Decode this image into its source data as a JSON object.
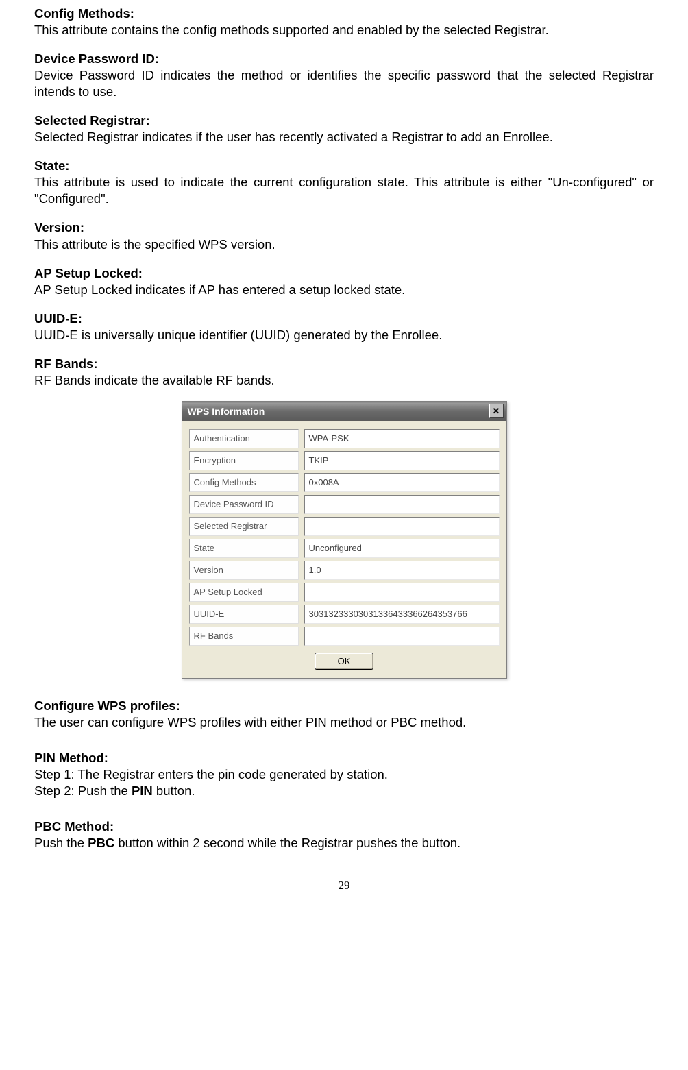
{
  "sections": {
    "configMethods": {
      "heading": "Config Methods:",
      "body": "This attribute contains the config methods supported and enabled by the selected Registrar."
    },
    "devicePasswordId": {
      "heading": "Device Password ID:",
      "body": "Device Password ID indicates the method or identifies the specific password that the selected Registrar intends to use."
    },
    "selectedRegistrar": {
      "heading": "Selected Registrar:",
      "body": "Selected Registrar indicates if the user has recently activated a Registrar to add an Enrollee."
    },
    "state": {
      "heading": "State:",
      "body": "This attribute is used to indicate the current configuration state. This attribute is either \"Un-configured\" or \"Configured\"."
    },
    "version": {
      "heading": "Version:",
      "body": "This attribute is the specified WPS version."
    },
    "apSetupLocked": {
      "heading": "AP Setup Locked:",
      "body": "AP Setup Locked indicates if AP has entered a setup locked state."
    },
    "uuidE": {
      "heading": "UUID-E:",
      "body": "UUID-E is universally unique identifier (UUID) generated by the Enrollee."
    },
    "rfBands": {
      "heading": "RF Bands:",
      "body": "RF Bands indicate the available RF bands."
    },
    "configureWps": {
      "heading": "Configure WPS profiles:",
      "body": "The user can configure WPS profiles with either PIN method or PBC method."
    },
    "pinMethod": {
      "heading": "PIN Method:",
      "step1": "Step 1: The Registrar enters the pin code generated by station.",
      "step2a": "Step 2: Push the ",
      "step2b": "PIN",
      "step2c": " button."
    },
    "pbcMethod": {
      "heading": "PBC Method:",
      "body1": "Push the ",
      "body2": "PBC",
      "body3": " button within 2 second while the Registrar pushes the button."
    }
  },
  "dialog": {
    "title": "WPS Information",
    "closeGlyph": "✕",
    "fields": [
      {
        "label": "Authentication",
        "value": "WPA-PSK"
      },
      {
        "label": "Encryption",
        "value": "TKIP"
      },
      {
        "label": "Config Methods",
        "value": "0x008A"
      },
      {
        "label": "Device Password ID",
        "value": ""
      },
      {
        "label": "Selected Registrar",
        "value": ""
      },
      {
        "label": "State",
        "value": "Unconfigured"
      },
      {
        "label": "Version",
        "value": "1.0"
      },
      {
        "label": "AP Setup Locked",
        "value": ""
      },
      {
        "label": "UUID-E",
        "value": "30313233303031336433366264353766"
      },
      {
        "label": "RF Bands",
        "value": ""
      }
    ],
    "okLabel": "OK"
  },
  "pageNumber": "29"
}
